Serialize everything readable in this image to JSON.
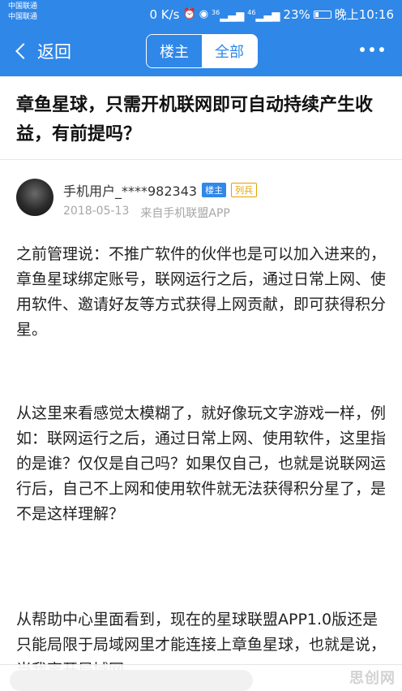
{
  "status_bar": {
    "carrier1": "中国联通",
    "carrier2": "中国联通",
    "speed": "0 K/s",
    "network1": "36",
    "network2": "46",
    "battery": "23%",
    "time": "晚上10:16"
  },
  "nav": {
    "back_label": "返回",
    "tabs": [
      {
        "label": "楼主",
        "active": true
      },
      {
        "label": "全部",
        "active": false
      }
    ]
  },
  "post": {
    "title": "章鱼星球，只需开机联网即可自动持续产生收益，有前提吗？",
    "author": {
      "name": "手机用户_****982343",
      "owner_badge": "楼主",
      "rank_badge": "列兵",
      "date": "2018-05-13",
      "source": "来自手机联盟APP"
    },
    "paragraphs": [
      "之前管理说：不推广软件的伙伴也是可以加入进来的，章鱼星球绑定账号，联网运行之后，通过日常上网、使用软件、邀请好友等方式获得上网贡献，即可获得积分星。",
      "从这里来看感觉太模糊了，就好像玩文字游戏一样，例如：联网运行之后，通过日常上网、使用软件，这里指的是谁？仅仅是自己吗？如果仅自己，也就是说联网运行后，自己不上网和使用软件就无法获得积分星了，是不是这样理解？",
      "从帮助中心里面看到，现在的星球联盟APP1.0版还是只能局限于局域网里才能连接上章鱼星球，也就是说，当我离开局域网"
    ]
  },
  "watermark": "思创网"
}
